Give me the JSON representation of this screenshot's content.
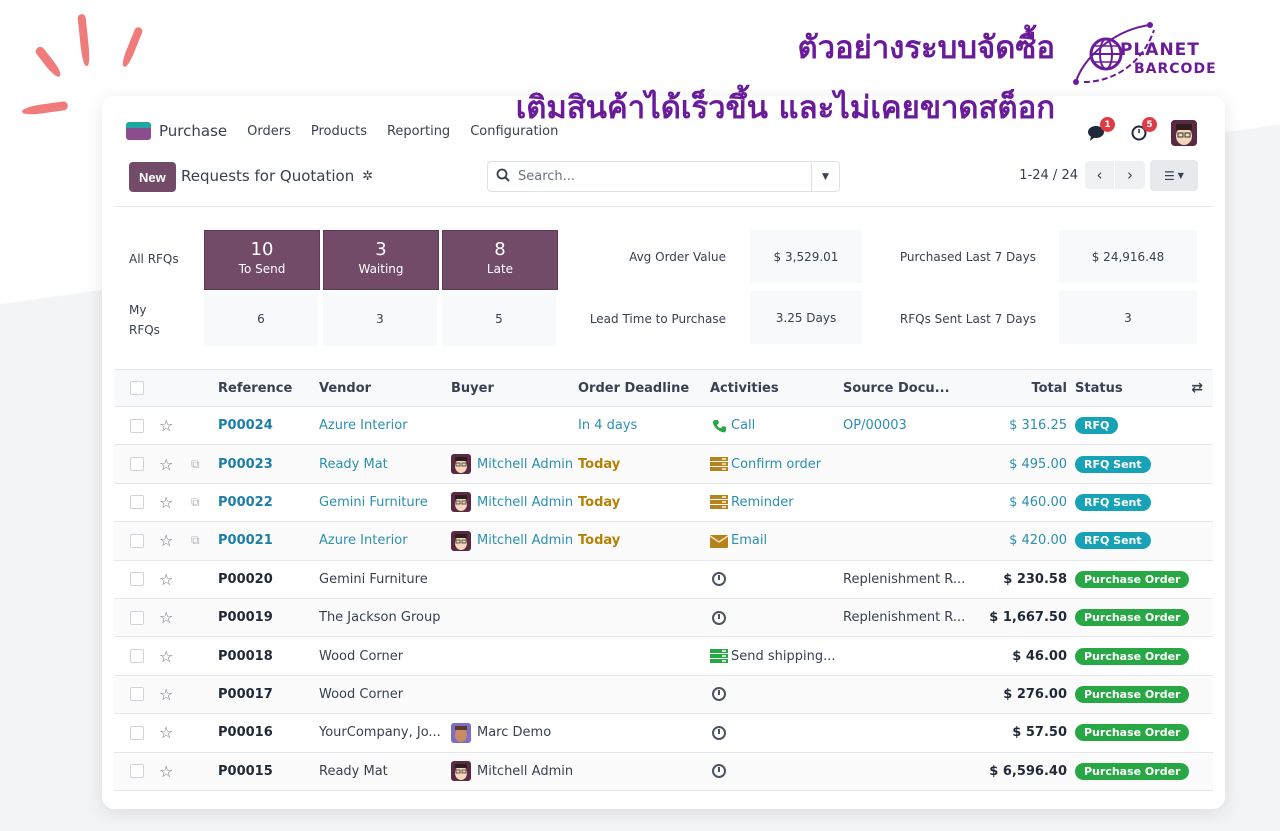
{
  "banner": {
    "line1": "ตัวอย่างระบบจัดซื้อ",
    "line2": "เติมสินค้าได้เร็วขึ้น และไม่เคยขาดสต็อก",
    "logo_top": "PLANET",
    "logo_bottom": "BARCODE",
    "accent_color": "#6a1b9a"
  },
  "navbar": {
    "app_name": "Purchase",
    "menu": [
      "Orders",
      "Products",
      "Reporting",
      "Configuration"
    ],
    "messages_badge": "1",
    "activities_badge": "5"
  },
  "control_panel": {
    "new_label": "New",
    "title": "Requests for Quotation",
    "search_placeholder": "Search...",
    "pager": "1-24 / 24",
    "prev_icon": "‹",
    "next_icon": "›"
  },
  "dashboard": {
    "all_label": "All RFQs",
    "my_label": "My RFQs",
    "tiles": [
      {
        "label": "To Send",
        "all": "10",
        "mine": "6"
      },
      {
        "label": "Waiting",
        "all": "3",
        "mine": "3"
      },
      {
        "label": "Late",
        "all": "8",
        "mine": "5"
      }
    ],
    "kpis": [
      {
        "label": "Avg Order Value",
        "value": "$ 3,529.01"
      },
      {
        "label": "Purchased Last 7 Days",
        "value": "$ 24,916.48"
      },
      {
        "label": "Lead Time to Purchase",
        "value": "3.25 Days"
      },
      {
        "label": "RFQs Sent Last 7 Days",
        "value": "3"
      }
    ]
  },
  "table": {
    "columns": [
      "Reference",
      "Vendor",
      "Buyer",
      "Order Deadline",
      "Activities",
      "Source Docu...",
      "Total",
      "Status"
    ],
    "rows": [
      {
        "ref": "P00024",
        "vendor": "Azure Interior",
        "buyer": "",
        "deadline": "In 4 days",
        "activity": "Call",
        "activity_icon": "phone",
        "source": "OP/00003",
        "total": "$ 316.25",
        "status": "RFQ",
        "kind": "rfq",
        "copy": false
      },
      {
        "ref": "P00023",
        "vendor": "Ready Mat",
        "buyer": "Mitchell Admin",
        "deadline": "Today",
        "activity": "Confirm order",
        "activity_icon": "todo",
        "source": "",
        "total": "$ 495.00",
        "status": "RFQ Sent",
        "kind": "rfq",
        "copy": true
      },
      {
        "ref": "P00022",
        "vendor": "Gemini Furniture",
        "buyer": "Mitchell Admin",
        "deadline": "Today",
        "activity": "Reminder",
        "activity_icon": "todo",
        "source": "",
        "total": "$ 460.00",
        "status": "RFQ Sent",
        "kind": "rfq",
        "copy": true
      },
      {
        "ref": "P00021",
        "vendor": "Azure Interior",
        "buyer": "Mitchell Admin",
        "deadline": "Today",
        "activity": "Email",
        "activity_icon": "email",
        "source": "",
        "total": "$ 420.00",
        "status": "RFQ Sent",
        "kind": "rfq",
        "copy": true
      },
      {
        "ref": "P00020",
        "vendor": "Gemini Furniture",
        "buyer": "",
        "deadline": "",
        "activity": "",
        "activity_icon": "clock",
        "source": "Replenishment R...",
        "total": "$ 230.58",
        "status": "Purchase Order",
        "kind": "po",
        "copy": false
      },
      {
        "ref": "P00019",
        "vendor": "The Jackson Group",
        "buyer": "",
        "deadline": "",
        "activity": "",
        "activity_icon": "clock",
        "source": "Replenishment R...",
        "total": "$ 1,667.50",
        "status": "Purchase Order",
        "kind": "po",
        "copy": false
      },
      {
        "ref": "P00018",
        "vendor": "Wood Corner",
        "buyer": "",
        "deadline": "",
        "activity": "Send shipping...",
        "activity_icon": "todo-green",
        "source": "",
        "total": "$ 46.00",
        "status": "Purchase Order",
        "kind": "po",
        "copy": false
      },
      {
        "ref": "P00017",
        "vendor": "Wood Corner",
        "buyer": "",
        "deadline": "",
        "activity": "",
        "activity_icon": "clock",
        "source": "",
        "total": "$ 276.00",
        "status": "Purchase Order",
        "kind": "po",
        "copy": false
      },
      {
        "ref": "P00016",
        "vendor": "YourCompany, Jo...",
        "buyer": "Marc Demo",
        "deadline": "",
        "activity": "",
        "activity_icon": "clock",
        "source": "",
        "total": "$ 57.50",
        "status": "Purchase Order",
        "kind": "po",
        "copy": false
      },
      {
        "ref": "P00015",
        "vendor": "Ready Mat",
        "buyer": "Mitchell Admin",
        "deadline": "",
        "activity": "",
        "activity_icon": "clock",
        "source": "",
        "total": "$ 6,596.40",
        "status": "Purchase Order",
        "kind": "po",
        "copy": false
      }
    ]
  }
}
